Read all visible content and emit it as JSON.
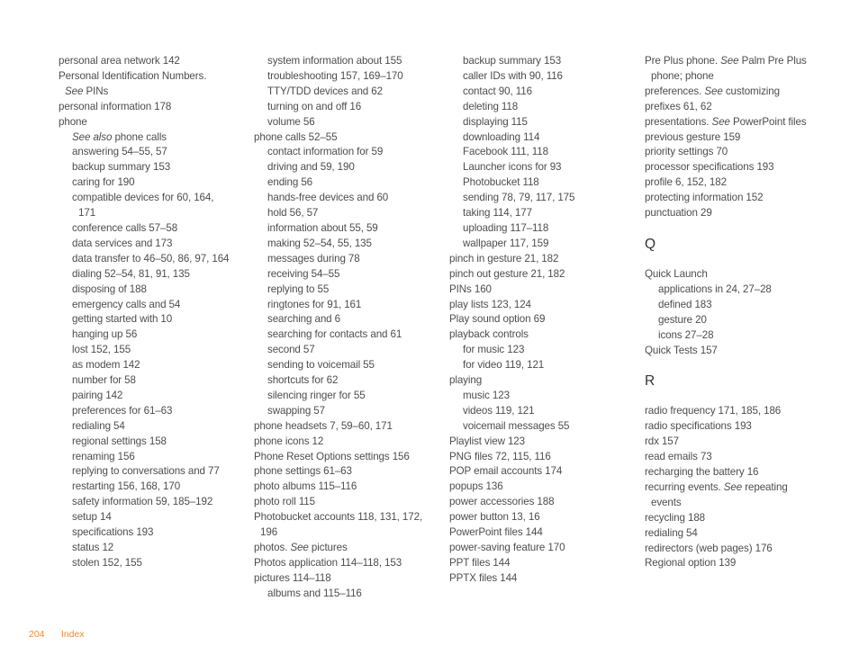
{
  "footer": {
    "page_number": "204",
    "section": "Index",
    "accent_color": "#f18a2a"
  },
  "columns": [
    [
      {
        "type": "entry",
        "level": 0,
        "text": "personal area network 142"
      },
      {
        "type": "entry",
        "level": 0,
        "text": "Personal Identification Numbers. "
      },
      {
        "type": "entry",
        "level": 0,
        "text": "See PINs",
        "cont": true
      },
      {
        "type": "entry",
        "level": 0,
        "text": "personal information 178"
      },
      {
        "type": "entry",
        "level": 0,
        "text": "phone"
      },
      {
        "type": "entry",
        "level": 1,
        "text": "See also phone calls"
      },
      {
        "type": "entry",
        "level": 1,
        "text": "answering 54–55, 57"
      },
      {
        "type": "entry",
        "level": 1,
        "text": "backup summary 153"
      },
      {
        "type": "entry",
        "level": 1,
        "text": "caring for 190"
      },
      {
        "type": "entry",
        "level": 1,
        "text": "compatible devices for 60, 164, 171"
      },
      {
        "type": "entry",
        "level": 1,
        "text": "conference calls 57–58"
      },
      {
        "type": "entry",
        "level": 1,
        "text": "data services and 173"
      },
      {
        "type": "entry",
        "level": 1,
        "text": "data transfer to 46–50, 86, 97, 164"
      },
      {
        "type": "entry",
        "level": 1,
        "text": "dialing 52–54, 81, 91, 135"
      },
      {
        "type": "entry",
        "level": 1,
        "text": "disposing of 188"
      },
      {
        "type": "entry",
        "level": 1,
        "text": "emergency calls and 54"
      },
      {
        "type": "entry",
        "level": 1,
        "text": "getting started with 10"
      },
      {
        "type": "entry",
        "level": 1,
        "text": "hanging up 56"
      },
      {
        "type": "entry",
        "level": 1,
        "text": "lost 152, 155"
      },
      {
        "type": "entry",
        "level": 1,
        "text": "as modem 142"
      },
      {
        "type": "entry",
        "level": 1,
        "text": "number for 58"
      },
      {
        "type": "entry",
        "level": 1,
        "text": "pairing 142"
      },
      {
        "type": "entry",
        "level": 1,
        "text": "preferences for 61–63"
      },
      {
        "type": "entry",
        "level": 1,
        "text": "redialing 54"
      },
      {
        "type": "entry",
        "level": 1,
        "text": "regional settings 158"
      },
      {
        "type": "entry",
        "level": 1,
        "text": "renaming 156"
      },
      {
        "type": "entry",
        "level": 1,
        "text": "replying to conversations and 77"
      },
      {
        "type": "entry",
        "level": 1,
        "text": "restarting 156, 168, 170"
      },
      {
        "type": "entry",
        "level": 1,
        "text": "safety information 59, 185–192"
      },
      {
        "type": "entry",
        "level": 1,
        "text": "setup 14"
      },
      {
        "type": "entry",
        "level": 1,
        "text": "specifications 193"
      },
      {
        "type": "entry",
        "level": 1,
        "text": "status 12"
      },
      {
        "type": "entry",
        "level": 1,
        "text": "stolen 152, 155"
      }
    ],
    [
      {
        "type": "entry",
        "level": 1,
        "text": "system information about 155"
      },
      {
        "type": "entry",
        "level": 1,
        "text": "troubleshooting 157, 169–170"
      },
      {
        "type": "entry",
        "level": 1,
        "text": "TTY/TDD devices and 62"
      },
      {
        "type": "entry",
        "level": 1,
        "text": "turning on and off 16"
      },
      {
        "type": "entry",
        "level": 1,
        "text": "volume 56"
      },
      {
        "type": "entry",
        "level": 0,
        "text": "phone calls 52–55"
      },
      {
        "type": "entry",
        "level": 1,
        "text": "contact information for 59"
      },
      {
        "type": "entry",
        "level": 1,
        "text": "driving and 59, 190"
      },
      {
        "type": "entry",
        "level": 1,
        "text": "ending 56"
      },
      {
        "type": "entry",
        "level": 1,
        "text": "hands-free devices and 60"
      },
      {
        "type": "entry",
        "level": 1,
        "text": "hold 56, 57"
      },
      {
        "type": "entry",
        "level": 1,
        "text": "information about 55, 59"
      },
      {
        "type": "entry",
        "level": 1,
        "text": "making 52–54, 55, 135"
      },
      {
        "type": "entry",
        "level": 1,
        "text": "messages during 78"
      },
      {
        "type": "entry",
        "level": 1,
        "text": "receiving 54–55"
      },
      {
        "type": "entry",
        "level": 1,
        "text": "replying to 55"
      },
      {
        "type": "entry",
        "level": 1,
        "text": "ringtones for 91, 161"
      },
      {
        "type": "entry",
        "level": 1,
        "text": "searching and 6"
      },
      {
        "type": "entry",
        "level": 1,
        "text": "searching for contacts and 61"
      },
      {
        "type": "entry",
        "level": 1,
        "text": "second 57"
      },
      {
        "type": "entry",
        "level": 1,
        "text": "sending to voicemail 55"
      },
      {
        "type": "entry",
        "level": 1,
        "text": "shortcuts for 62"
      },
      {
        "type": "entry",
        "level": 1,
        "text": "silencing ringer for 55"
      },
      {
        "type": "entry",
        "level": 1,
        "text": "swapping 57"
      },
      {
        "type": "entry",
        "level": 0,
        "text": "phone headsets 7, 59–60, 171"
      },
      {
        "type": "entry",
        "level": 0,
        "text": "phone icons 12"
      },
      {
        "type": "entry",
        "level": 0,
        "text": "Phone Reset Options settings 156"
      },
      {
        "type": "entry",
        "level": 0,
        "text": "phone settings 61–63"
      },
      {
        "type": "entry",
        "level": 0,
        "text": "photo albums 115–116"
      },
      {
        "type": "entry",
        "level": 0,
        "text": "photo roll 115"
      },
      {
        "type": "entry",
        "level": 0,
        "text": "Photobucket accounts 118, 131, 172, 196"
      },
      {
        "type": "entry",
        "level": 0,
        "text": "photos. See pictures"
      },
      {
        "type": "entry",
        "level": 0,
        "text": "Photos application 114–118, 153"
      },
      {
        "type": "entry",
        "level": 0,
        "text": "pictures 114–118"
      },
      {
        "type": "entry",
        "level": 1,
        "text": "albums and 115–116"
      }
    ],
    [
      {
        "type": "entry",
        "level": 1,
        "text": "backup summary 153"
      },
      {
        "type": "entry",
        "level": 1,
        "text": "caller IDs with 90, 116"
      },
      {
        "type": "entry",
        "level": 1,
        "text": "contact 90, 116"
      },
      {
        "type": "entry",
        "level": 1,
        "text": "deleting 118"
      },
      {
        "type": "entry",
        "level": 1,
        "text": "displaying 115"
      },
      {
        "type": "entry",
        "level": 1,
        "text": "downloading 114"
      },
      {
        "type": "entry",
        "level": 1,
        "text": "Facebook 111, 118"
      },
      {
        "type": "entry",
        "level": 1,
        "text": "Launcher icons for 93"
      },
      {
        "type": "entry",
        "level": 1,
        "text": "Photobucket 118"
      },
      {
        "type": "entry",
        "level": 1,
        "text": "sending 78, 79, 117, 175"
      },
      {
        "type": "entry",
        "level": 1,
        "text": "taking 114, 177"
      },
      {
        "type": "entry",
        "level": 1,
        "text": "uploading 117–118"
      },
      {
        "type": "entry",
        "level": 1,
        "text": "wallpaper 117, 159"
      },
      {
        "type": "entry",
        "level": 0,
        "text": "pinch in gesture 21, 182"
      },
      {
        "type": "entry",
        "level": 0,
        "text": "pinch out gesture 21, 182"
      },
      {
        "type": "entry",
        "level": 0,
        "text": "PINs 160"
      },
      {
        "type": "entry",
        "level": 0,
        "text": "play lists 123, 124"
      },
      {
        "type": "entry",
        "level": 0,
        "text": "Play sound option 69"
      },
      {
        "type": "entry",
        "level": 0,
        "text": "playback controls"
      },
      {
        "type": "entry",
        "level": 1,
        "text": "for music 123"
      },
      {
        "type": "entry",
        "level": 1,
        "text": "for video 119, 121"
      },
      {
        "type": "entry",
        "level": 0,
        "text": "playing"
      },
      {
        "type": "entry",
        "level": 1,
        "text": "music 123"
      },
      {
        "type": "entry",
        "level": 1,
        "text": "videos 119, 121"
      },
      {
        "type": "entry",
        "level": 1,
        "text": "voicemail messages 55"
      },
      {
        "type": "entry",
        "level": 0,
        "text": "Playlist view 123"
      },
      {
        "type": "entry",
        "level": 0,
        "text": "PNG files 72, 115, 116"
      },
      {
        "type": "entry",
        "level": 0,
        "text": "POP email accounts 174"
      },
      {
        "type": "entry",
        "level": 0,
        "text": "popups 136"
      },
      {
        "type": "entry",
        "level": 0,
        "text": "power accessories 188"
      },
      {
        "type": "entry",
        "level": 0,
        "text": "power button 13, 16"
      },
      {
        "type": "entry",
        "level": 0,
        "text": "PowerPoint files 144"
      },
      {
        "type": "entry",
        "level": 0,
        "text": "power-saving feature 170"
      },
      {
        "type": "entry",
        "level": 0,
        "text": "PPT files 144"
      },
      {
        "type": "entry",
        "level": 0,
        "text": "PPTX files 144"
      }
    ],
    [
      {
        "type": "entry",
        "level": 0,
        "text": "Pre Plus phone. See Palm Pre Plus phone; phone"
      },
      {
        "type": "entry",
        "level": 0,
        "text": "preferences. See customizing"
      },
      {
        "type": "entry",
        "level": 0,
        "text": "prefixes 61, 62"
      },
      {
        "type": "entry",
        "level": 0,
        "text": "presentations. See PowerPoint files"
      },
      {
        "type": "entry",
        "level": 0,
        "text": "previous gesture 159"
      },
      {
        "type": "entry",
        "level": 0,
        "text": "priority settings 70"
      },
      {
        "type": "entry",
        "level": 0,
        "text": "processor specifications 193"
      },
      {
        "type": "entry",
        "level": 0,
        "text": "profile 6, 152, 182"
      },
      {
        "type": "entry",
        "level": 0,
        "text": "protecting information 152"
      },
      {
        "type": "entry",
        "level": 0,
        "text": "punctuation 29"
      },
      {
        "type": "letter",
        "text": "Q"
      },
      {
        "type": "entry",
        "level": 0,
        "text": "Quick Launch"
      },
      {
        "type": "entry",
        "level": 1,
        "text": "applications in 24, 27–28"
      },
      {
        "type": "entry",
        "level": 1,
        "text": "defined 183"
      },
      {
        "type": "entry",
        "level": 1,
        "text": "gesture 20"
      },
      {
        "type": "entry",
        "level": 1,
        "text": "icons 27–28"
      },
      {
        "type": "entry",
        "level": 0,
        "text": "Quick Tests 157"
      },
      {
        "type": "letter",
        "text": "R"
      },
      {
        "type": "entry",
        "level": 0,
        "text": "radio frequency 171, 185, 186"
      },
      {
        "type": "entry",
        "level": 0,
        "text": "radio specifications 193"
      },
      {
        "type": "entry",
        "level": 0,
        "text": "rdx 157"
      },
      {
        "type": "entry",
        "level": 0,
        "text": "read emails 73"
      },
      {
        "type": "entry",
        "level": 0,
        "text": "recharging the battery 16"
      },
      {
        "type": "entry",
        "level": 0,
        "text": "recurring events. See repeating events"
      },
      {
        "type": "entry",
        "level": 0,
        "text": "recycling 188"
      },
      {
        "type": "entry",
        "level": 0,
        "text": "redialing 54"
      },
      {
        "type": "entry",
        "level": 0,
        "text": "redirectors (web pages) 176"
      },
      {
        "type": "entry",
        "level": 0,
        "text": "Regional option 139"
      }
    ]
  ]
}
